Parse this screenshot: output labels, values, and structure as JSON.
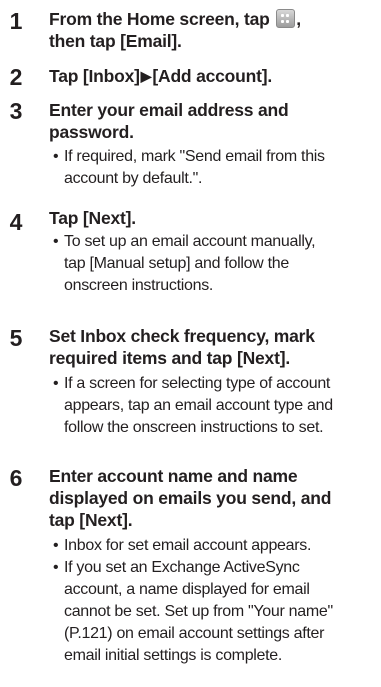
{
  "steps": [
    {
      "number": "1",
      "title_lines": [
        "From the Home screen, tap",
        ", then tap [Email]."
      ],
      "bullets": []
    },
    {
      "number": "2",
      "title_lines": [
        "Tap [Inbox]",
        "▶",
        "[Add account]."
      ],
      "bullets": []
    },
    {
      "number": "3",
      "title_lines": [
        "Enter your email address and",
        "password."
      ],
      "bullets": [
        {
          "lines": [
            "If required, mark \"Send email from this",
            "account by default.\"."
          ]
        }
      ]
    },
    {
      "number": "4",
      "title_lines": [
        "Tap [Next]."
      ],
      "bullets": [
        {
          "lines": [
            "To set up an email account manually,",
            "tap [Manual setup] and follow the",
            "onscreen instructions."
          ]
        }
      ]
    },
    {
      "number": "5",
      "title_lines": [
        "Set Inbox check frequency, mark",
        "required items and tap [Next]."
      ],
      "bullets": [
        {
          "lines": [
            "If a screen for selecting type of account",
            "appears, tap an email account type and",
            "follow the onscreen instructions to set."
          ]
        }
      ]
    },
    {
      "number": "6",
      "title_lines": [
        "Enter account name and name",
        "displayed on emails you send, and",
        "tap [Next]."
      ],
      "bullets": [
        {
          "lines": [
            "Inbox for set email account appears."
          ]
        },
        {
          "lines": [
            "If you set an Exchange ActiveSync",
            "account, a name displayed for email",
            "cannot be set. Set up from \"Your name\"",
            "(P.121) on email account settings after",
            "email initial settings is complete."
          ]
        }
      ]
    }
  ],
  "bullet_char": "•",
  "icons": {
    "home_apps": "apps-grid-icon"
  }
}
